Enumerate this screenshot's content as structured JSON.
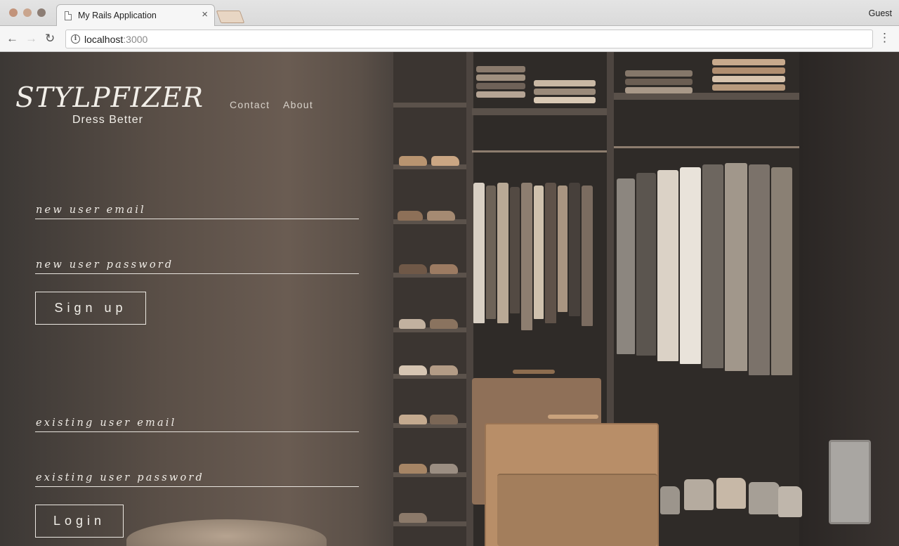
{
  "browser": {
    "tab_title": "My Rails Application",
    "tab_close": "×",
    "profile": "Guest",
    "url_host": "localhost",
    "url_port": ":3000",
    "back_icon": "←",
    "forward_icon": "→",
    "reload_icon": "↻",
    "menu_icon": "⋮",
    "info_icon": "i"
  },
  "site": {
    "logo": "STYLPFIZER",
    "tagline": "Dress Better",
    "nav": [
      {
        "label": "Contact"
      },
      {
        "label": "About"
      }
    ]
  },
  "signup": {
    "email_placeholder": "new user email",
    "password_placeholder": "new user password",
    "button_label": "Sign up"
  },
  "login": {
    "email_placeholder": "existing user email",
    "password_placeholder": "existing user password",
    "button_label": "Login"
  },
  "colors": {
    "text_light": "#f2efe9",
    "background_dark": "#3c3835",
    "background_warm": "#6a5c52"
  }
}
